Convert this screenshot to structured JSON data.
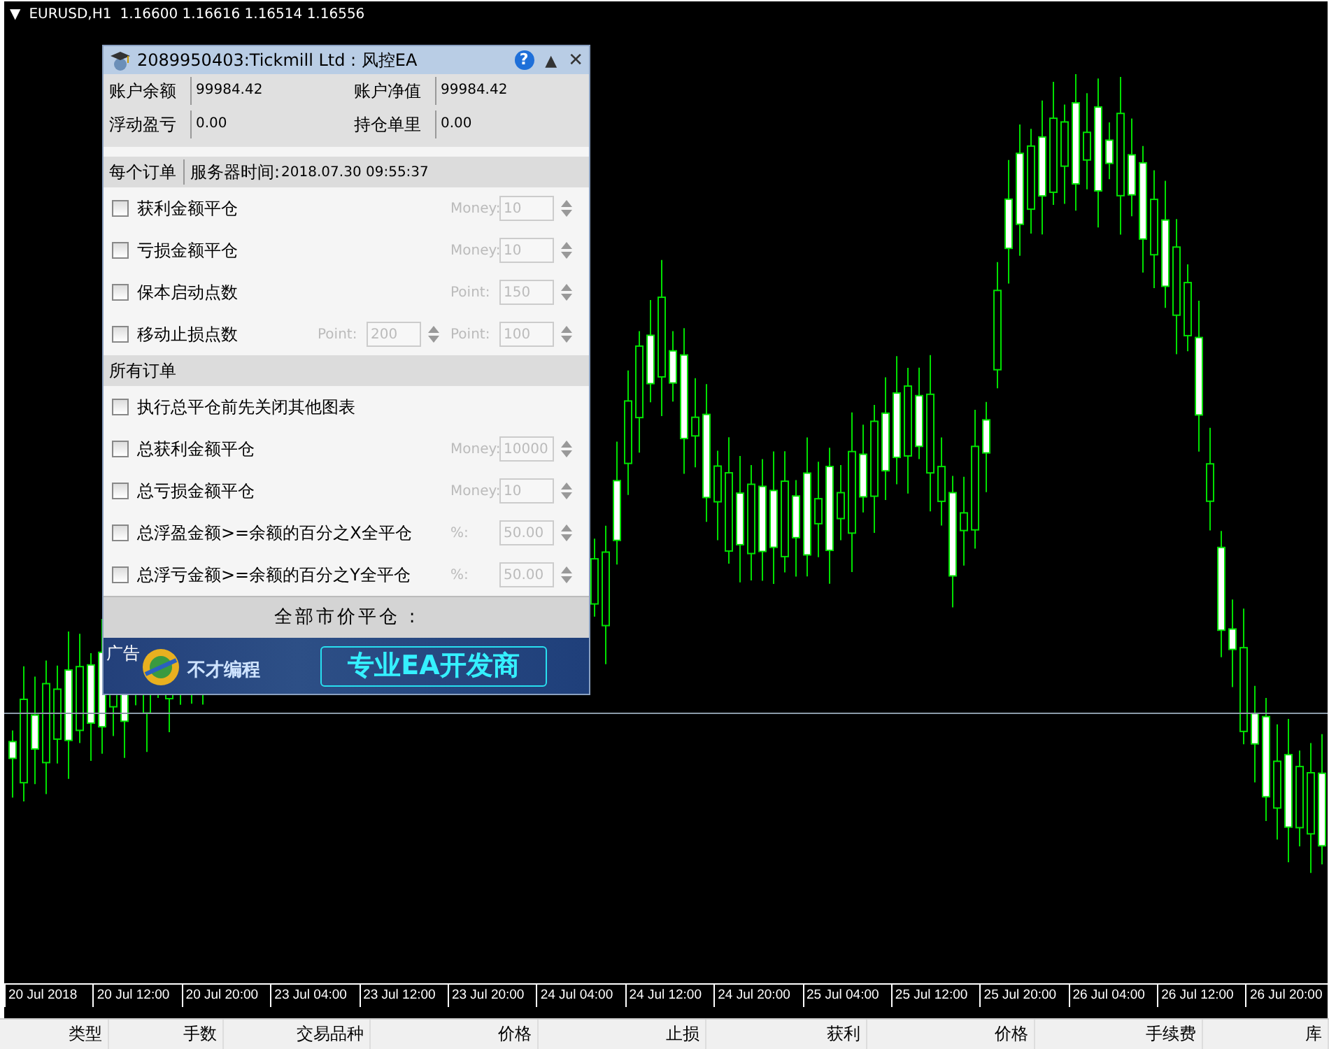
{
  "chart_window": {
    "menu_symbol": "▼",
    "symbol": "EURUSD,H1",
    "quote": "1.16600 1.16616 1.16514 1.16556"
  },
  "ea_panel": {
    "title": "2089950403:Tickmill Ltd : 风控EA",
    "help_symbol": "?",
    "minimize_symbol": "▲",
    "close_symbol": "✕",
    "account": [
      {
        "label": "账户余额",
        "value": "99984.42"
      },
      {
        "label": "账户净值",
        "value": "99984.42"
      },
      {
        "label": "浮动盈亏",
        "value": "0.00"
      },
      {
        "label": "持仓单里",
        "value": "0.00"
      }
    ],
    "per_order": {
      "header": "每个订单",
      "server_time_label": "服务器时间:",
      "server_time": "2018.07.30 09:55:37",
      "rows": [
        {
          "label": "获利金额平仓",
          "checked": false,
          "inputs": [
            {
              "label": "Money:",
              "value": "10",
              "disabled": true
            }
          ]
        },
        {
          "label": "亏损金额平仓",
          "checked": false,
          "inputs": [
            {
              "label": "Money:",
              "value": "10",
              "disabled": true
            }
          ]
        },
        {
          "label": "保本启动点数",
          "checked": false,
          "inputs": [
            {
              "label": "Point:",
              "value": "150",
              "disabled": true
            }
          ]
        },
        {
          "label": "移动止损点数",
          "checked": false,
          "inputs": [
            {
              "label": "Point:",
              "value": "200",
              "disabled": true
            },
            {
              "label": "Point:",
              "value": "100",
              "disabled": true
            }
          ]
        }
      ]
    },
    "all_orders": {
      "header": "所有订单",
      "rows": [
        {
          "label": "执行总平仓前先关闭其他图表",
          "checked": false,
          "inputs": []
        },
        {
          "label": "总获利金额平仓",
          "checked": false,
          "inputs": [
            {
              "label": "Money:",
              "value": "10000",
              "disabled": true
            }
          ]
        },
        {
          "label": "总亏损金额平仓",
          "checked": false,
          "inputs": [
            {
              "label": "Money:",
              "value": "10",
              "disabled": true
            }
          ]
        },
        {
          "label": "总浮盈金额>=余额的百分之X全平仓",
          "checked": false,
          "inputs": [
            {
              "label": "%:",
              "value": "50.00",
              "disabled": true
            }
          ]
        },
        {
          "label": "总浮亏金额>=余额的百分之Y全平仓",
          "checked": false,
          "inputs": [
            {
              "label": "%:",
              "value": "50.00",
              "disabled": true
            }
          ]
        }
      ]
    },
    "close_all_button": "全部市价平仓 :",
    "ad": {
      "label": "广告",
      "brand": "不才编程",
      "slogan": "专业EA开发商"
    }
  },
  "time_axis": [
    "20 Jul 2018",
    "20 Jul 12:00",
    "20 Jul 20:00",
    "23 Jul 04:00",
    "23 Jul 12:00",
    "23 Jul 20:00",
    "24 Jul 04:00",
    "24 Jul 12:00",
    "24 Jul 20:00",
    "25 Jul 04:00",
    "25 Jul 12:00",
    "25 Jul 20:00",
    "26 Jul 04:00",
    "26 Jul 12:00",
    "26 Jul 20:00"
  ],
  "terminal_columns": [
    "类型",
    "手数",
    "交易品种",
    "价格",
    "止损",
    "获利",
    "价格",
    "手续费",
    "库"
  ]
}
